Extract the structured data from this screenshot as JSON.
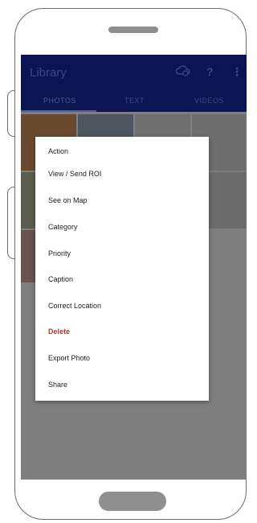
{
  "app": {
    "title": "Library",
    "actions": [
      {
        "name": "cloud-sync-icon",
        "glyph": "☁"
      },
      {
        "name": "help-icon",
        "glyph": "?"
      },
      {
        "name": "overflow-menu-icon",
        "glyph": "⋮"
      }
    ]
  },
  "tabs": [
    {
      "label": "PHOTOS",
      "active": true
    },
    {
      "label": "TEXT",
      "active": false
    },
    {
      "label": "VIDEOS",
      "active": false
    }
  ],
  "menu": {
    "items": [
      {
        "label": "Action",
        "style": "normal"
      },
      {
        "label": "View / Send ROI",
        "style": "normal"
      },
      {
        "label": "See on Map",
        "style": "normal"
      },
      {
        "label": "Category",
        "style": "normal"
      },
      {
        "label": "Priority",
        "style": "normal"
      },
      {
        "label": "Caption",
        "style": "normal"
      },
      {
        "label": "Correct Location",
        "style": "normal"
      },
      {
        "label": "Delete",
        "style": "danger"
      },
      {
        "label": "Export Photo",
        "style": "normal"
      },
      {
        "label": "Share",
        "style": "normal"
      }
    ]
  },
  "colors": {
    "appbar": "#0b1554",
    "scrim": "#7f7f7f",
    "danger": "#b03a2e"
  }
}
